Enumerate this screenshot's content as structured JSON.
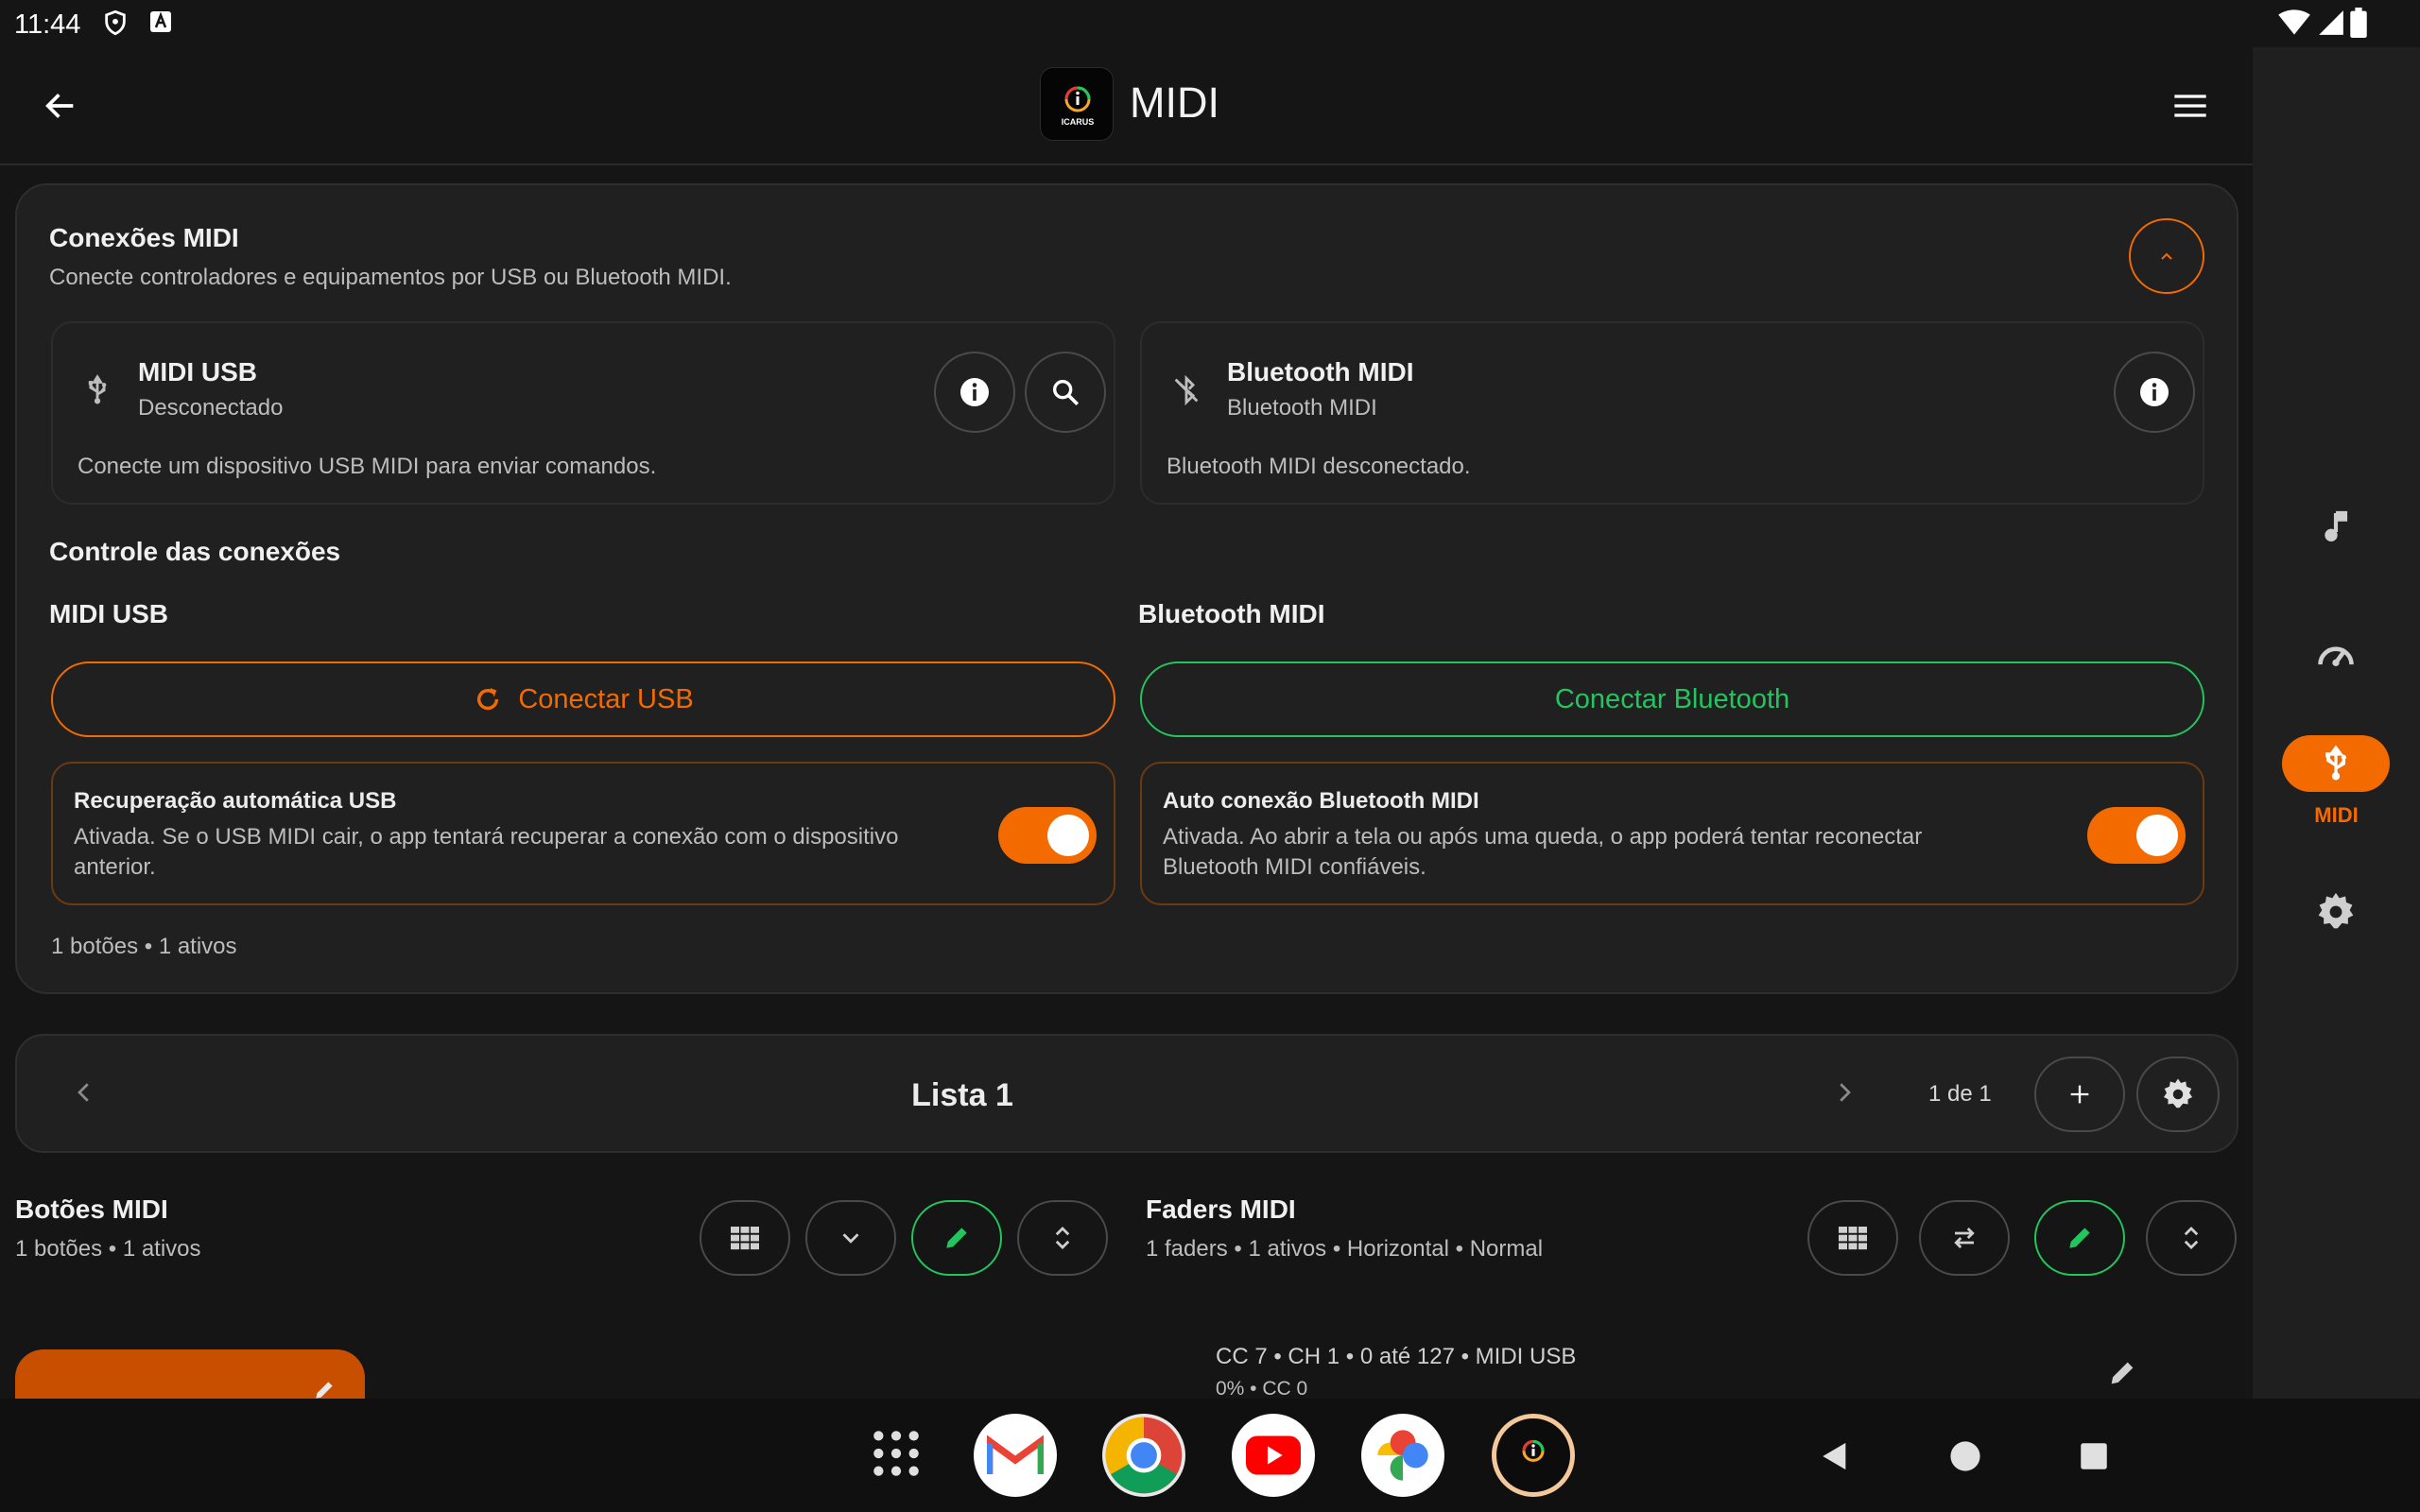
{
  "status_bar": {
    "time": "11:44"
  },
  "app_bar": {
    "title": "MIDI",
    "logo_text": "ICARUS"
  },
  "nav_rail": {
    "active_label": "MIDI"
  },
  "connections": {
    "title": "Conexões MIDI",
    "subtitle": "Conecte controladores e equipamentos por USB ou Bluetooth MIDI.",
    "usb_card": {
      "title": "MIDI USB",
      "status": "Desconectado",
      "description": "Conecte um dispositivo USB MIDI para enviar comandos."
    },
    "bt_card": {
      "title": "Bluetooth MIDI",
      "status": "Bluetooth MIDI",
      "description": "Bluetooth MIDI desconectado."
    },
    "control_title": "Controle das conexões",
    "usb_label": "MIDI USB",
    "bt_label": "Bluetooth MIDI",
    "connect_usb": "Conectar USB",
    "connect_bt": "Conectar Bluetooth",
    "usb_recovery": {
      "title": "Recuperação automática USB",
      "desc1": "Ativada. Se o USB MIDI cair, o app tentará recuperar a conexão com o dispositivo",
      "desc2": "anterior.",
      "enabled": true
    },
    "bt_auto": {
      "title": "Auto conexão Bluetooth MIDI",
      "desc1": "Ativada. Ao abrir a tela ou após uma queda, o app poderá tentar reconectar",
      "desc2": "Bluetooth MIDI confiáveis.",
      "enabled": true
    },
    "summary": "1 botões • 1 ativos"
  },
  "list_bar": {
    "title": "Lista 1",
    "page": "1 de 1"
  },
  "buttons_section": {
    "title": "Botões MIDI",
    "summary": "1 botões • 1 ativos"
  },
  "faders_section": {
    "title": "Faders MIDI",
    "summary": "1 faders • 1 ativos • Horizontal • Normal"
  },
  "fader_item": {
    "line1": "CC 7 • CH 1 • 0 até 127 • MIDI USB",
    "line2": "0% • CC 0"
  },
  "colors": {
    "accent": "#f36b00",
    "green": "#22c55e",
    "background": "#151515",
    "card": "#202020"
  }
}
